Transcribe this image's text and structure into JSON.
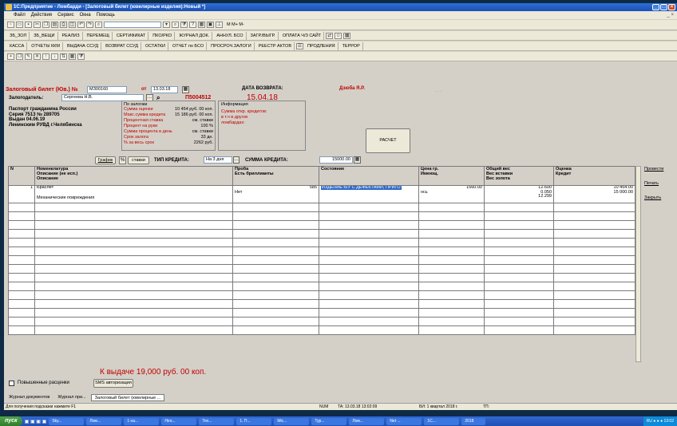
{
  "window": {
    "title": "1С:Предприятие - Ломбарди - [Залоговый билет (ювелирные изделия):Новый *]"
  },
  "menu": [
    "Файл",
    "Действия",
    "Сервис",
    "Окна",
    "Помощь"
  ],
  "toolbar1": {
    "combo_value": "",
    "extra": "М  М+  М-"
  },
  "toolbar2": [
    "ЗБ_ЗОЛ",
    "ЗБ_ВЕЩИ",
    "РЕАЛИЗ",
    "ПЕРЕМЕЩ",
    "СЕРТИФИКАТ",
    "ПКО/РКО",
    "ЖУРНАЛ ДОК.",
    "АННУЛ. БСО",
    "ЗАГР./ВЫГР.",
    "ОПЛАТА Ч/З САЙТ"
  ],
  "toolbar3": [
    "КАССА",
    "ОТЧЕТЫ ККМ",
    "ВЫДАЧА ССУД",
    "ВОЗВРАТ ССУД",
    "ОСТАТКИ",
    "ОТЧЕТ по БСО",
    "ПРОСРОЧ.ЗАЛОГИ",
    "РЕЕСТР АКТОВ",
    "ПРОДЛЕНИЯ",
    "ТЕРРОР"
  ],
  "form": {
    "title_label": "Залоговый билет (Юв.) №",
    "number": "МЗ00160",
    "date_prefix": "от",
    "date": "13.03.18",
    "pledger_label": "Залогодатель:",
    "pledger": "Сергеева Н.В.",
    "code": "П5004512",
    "return_label": "ДАТА ВОЗВРАТА:",
    "return_date": "15.04.18",
    "appraiser": "Дзюба Я.Р.",
    "passport": [
      "Паспорт гражданина России",
      "Серия 7513  № 289705",
      "Выдан 04.06.19",
      "Ленинским РУВД г.Челябинска"
    ],
    "loan_info_header": "По залогам",
    "loan_info": [
      [
        "Сумма оценки",
        "10 454 руб. 00 коп."
      ],
      [
        "Макс.сумма кредита",
        "15 186 руб. 00 коп."
      ],
      [
        "Процентная ставка",
        "см. ставки"
      ],
      [
        "Процент на руки",
        "100 %"
      ],
      [
        "Сумма процента в день",
        "см. ставки"
      ],
      [
        "Срок залога",
        "33 дн."
      ],
      [
        "% за весь срок",
        "2262 руб."
      ]
    ],
    "info_header": "Информация",
    "info_lines": [
      "Сумма откр. кредитов:",
      "в т.ч в других",
      "ломбардах:"
    ],
    "calc_button": "РАСЧЕТ",
    "schedule_button": "График",
    "rates_button": "ставки",
    "credit_type_label": "ТИП КРЕДИТА:",
    "credit_type": "На 3 дня",
    "credit_sum_label": "СУММА КРЕДИТА:",
    "credit_sum": "15000.00"
  },
  "table": {
    "headers": [
      [
        "N"
      ],
      [
        "Номенклатура",
        "Описание (не исп.)",
        "Описание"
      ],
      [
        "Проба",
        "Есть бриллианты"
      ],
      [
        "Состояние"
      ],
      [
        "Цена гр.",
        "Имеющ."
      ],
      [
        "Общий вес",
        "Вес вставки",
        "Вес золота"
      ],
      [
        "Оценка",
        "Кредит"
      ]
    ],
    "rows": [
      {
        "n": "1",
        "name": "Браслет",
        "desc": "Механические повреждения",
        "proba": "585",
        "diamonds": "Нет",
        "state": "ИЗДЕЛИЕ Б/У С ДЕФЕКТАМИ, ПРИГО",
        "price": "1560.00",
        "has": "нсь",
        "w_total": "12.600",
        "w_insert": "0.050",
        "w_gold": "12.299",
        "estimate": "10 454.00",
        "credit": "15 000.00"
      }
    ]
  },
  "side_buttons": [
    "Провести",
    "Печать",
    "Закрыть"
  ],
  "payout_text": "К выдаче 19,000 руб. 00 коп.",
  "raised_rates_label": "Повышенные расценки",
  "sms_button": "SMS авторизация",
  "window_tabs": [
    "Журнал документов",
    "Журнал при...",
    "Залоговый билет (ювелирные ..."
  ],
  "status": {
    "hint": "Для получения подсказки нажмите F1",
    "num": "NUM",
    "ta": "ТА: 13.03.18 13:02:09",
    "bi": "БИ: 1 квартал 2018 г.",
    "tp": "ТП:"
  },
  "taskbar": {
    "start": "пуск",
    "tasks": [
      "Sky...",
      "Лом...",
      "1 на...",
      "Нео...",
      "Тех...",
      "1. П...",
      "Mic...",
      "Тур...",
      "Лом...",
      "Net ...",
      "1С...",
      "2018"
    ],
    "lang": "RU",
    "clock": "13:02"
  }
}
